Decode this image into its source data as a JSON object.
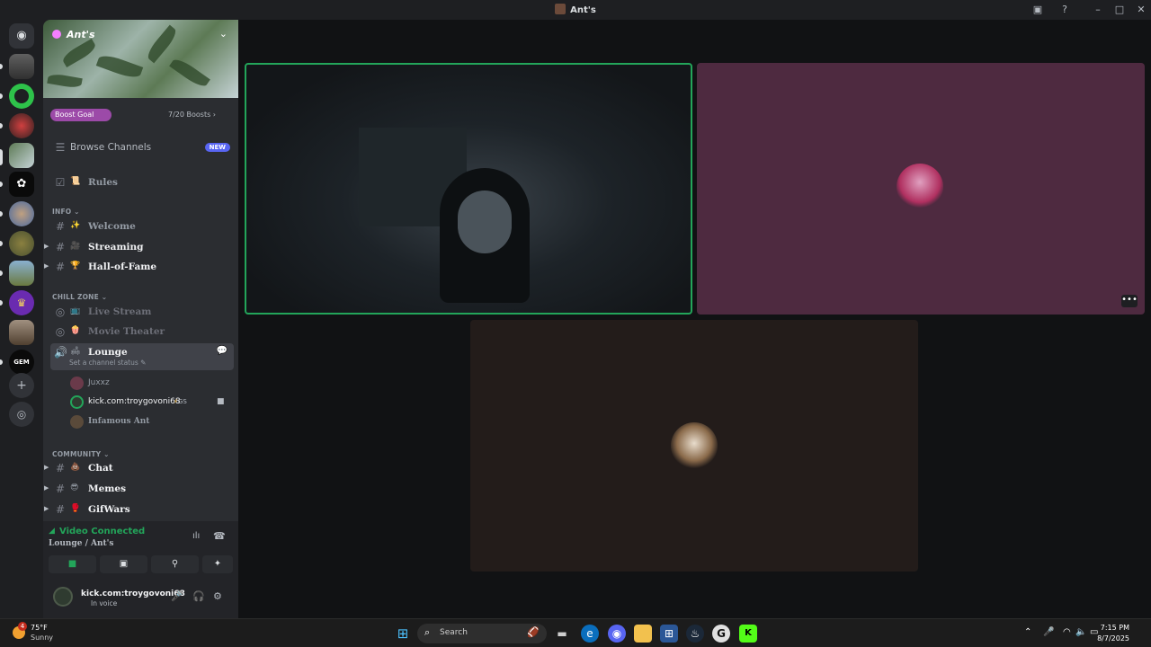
{
  "window": {
    "title": "Ant's"
  },
  "server": {
    "name": "Ant's",
    "boost_label": "Boost Goal",
    "boost_count": "7/20 Boosts",
    "boost_progress": 0.35
  },
  "browse": {
    "label": "Browse Channels",
    "badge": "NEW"
  },
  "channels": {
    "rules": "Rules",
    "cat_info": "INFO",
    "welcome": "Welcome",
    "streaming": "Streaming",
    "hall": "Hall-of-Fame",
    "cat_chill": "CHILL ZONE",
    "live_stream": "Live Stream",
    "movie_theater": "Movie Theater",
    "lounge": "Lounge",
    "lounge_status": "Set a channel status",
    "cat_community": "COMMUNITY",
    "chat": "Chat",
    "memes": "Memes",
    "gifwars": "GifWars"
  },
  "voice_users": [
    {
      "name": "Juxxz"
    },
    {
      "name": "kick.com:troygovoni68",
      "tag": "GS"
    },
    {
      "name": "Infamous Ant"
    }
  ],
  "voice_panel": {
    "status": "Video Connected",
    "location": "Lounge / Ant's"
  },
  "user": {
    "name": "kick.com:troygovoni68",
    "status": "In voice"
  },
  "taskbar": {
    "temp": "75°F",
    "condition": "Sunny",
    "notif_count": "4",
    "search_placeholder": "Search",
    "time": "7:15 PM",
    "date": "8/7/2025"
  },
  "colors": {
    "connected": "#23a55a",
    "boost": "#9c4aa8",
    "accent": "#5865f2"
  }
}
